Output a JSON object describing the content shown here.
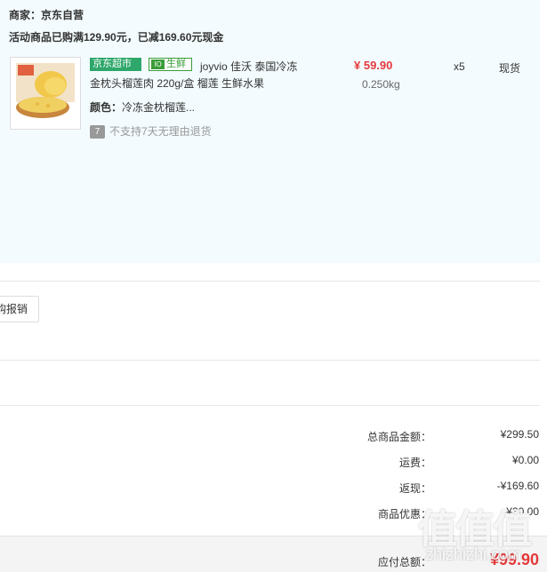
{
  "order": {
    "merchant_label": "商家：京东自营",
    "promo_text": "活动商品已购满129.90元，已减169.60元现金"
  },
  "item": {
    "tag_jd": "京东超市",
    "tag_fresh": "生鲜",
    "tag_fresh_icon": "fresh-icon",
    "title_line1": "joyvio 佳沃 泰国冷冻",
    "title_line2": "金枕头榴莲肉 220g/盒 榴莲 生鲜水果",
    "color_label": "颜色：",
    "color_value": "冷冻金枕榴莲...",
    "no_return_icon": "7",
    "no_return_text": "不支持7天无理由退货",
    "price": "¥ 59.90",
    "weight": "0.250kg",
    "quantity": "x5",
    "stock": "现货"
  },
  "actions": {
    "invoice_button": "购报销"
  },
  "summary": [
    {
      "label": "总商品金额：",
      "value": "¥299.50"
    },
    {
      "label": "运费：",
      "value": "¥0.00"
    },
    {
      "label": "返现：",
      "value": "-¥169.60"
    },
    {
      "label": "商品优惠：",
      "value": "-¥30.00"
    }
  ],
  "footer": {
    "pay_label": "应付总额：",
    "pay_value": "¥99.90"
  },
  "watermark": {
    "logo_text": "值值值",
    "url": "zhizhizhi.com"
  },
  "colors": {
    "panel_bg": "#f3fbfe",
    "price_red": "#e4393c",
    "jd_green": "#2ea76a",
    "fresh_green": "#3a9d39"
  }
}
